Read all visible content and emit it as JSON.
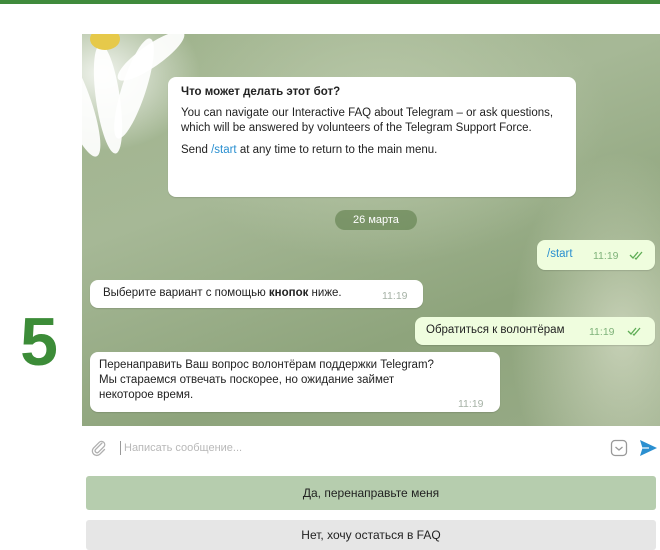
{
  "step": {
    "number": "5"
  },
  "colors": {
    "accent_green": "#3c8c38",
    "send_blue": "#2a8fd0",
    "keyboard_button": "#b6cdae"
  },
  "bot_info": {
    "title": "Что может делать этот бот?",
    "paragraph": "You can navigate our Interactive FAQ about Telegram – or ask questions, which will be answered by volunteers of the Telegram Support Force.",
    "send_prefix": "Send ",
    "command": "/start",
    "send_suffix": " at any time to return to the main menu."
  },
  "date_separator": "26 марта",
  "messages": [
    {
      "direction": "out",
      "text": "/start",
      "time": "11:19",
      "read": true
    },
    {
      "direction": "in",
      "text_before": "Выберите вариант с помощью ",
      "text_bold": "кнопок",
      "text_after": " ниже.",
      "time": "11:19"
    },
    {
      "direction": "out",
      "text": "Обратиться к волонтёрам",
      "time": "11:19",
      "read": true
    },
    {
      "direction": "in",
      "text": "Перенаправить Ваш вопрос волонтёрам поддержки Telegram? Мы стараемся отвечать поскорее, но ожидание займет некоторое время.",
      "time": "11:19"
    }
  ],
  "composer": {
    "placeholder": "Написать сообщение...",
    "attach_icon": "paperclip-icon",
    "emoji_icon": "sticker-icon",
    "send_icon": "send-arrow-icon"
  },
  "keyboard": [
    {
      "label": "Да, перенаправьте меня"
    },
    {
      "label": "Нет, хочу остаться в FAQ"
    }
  ]
}
